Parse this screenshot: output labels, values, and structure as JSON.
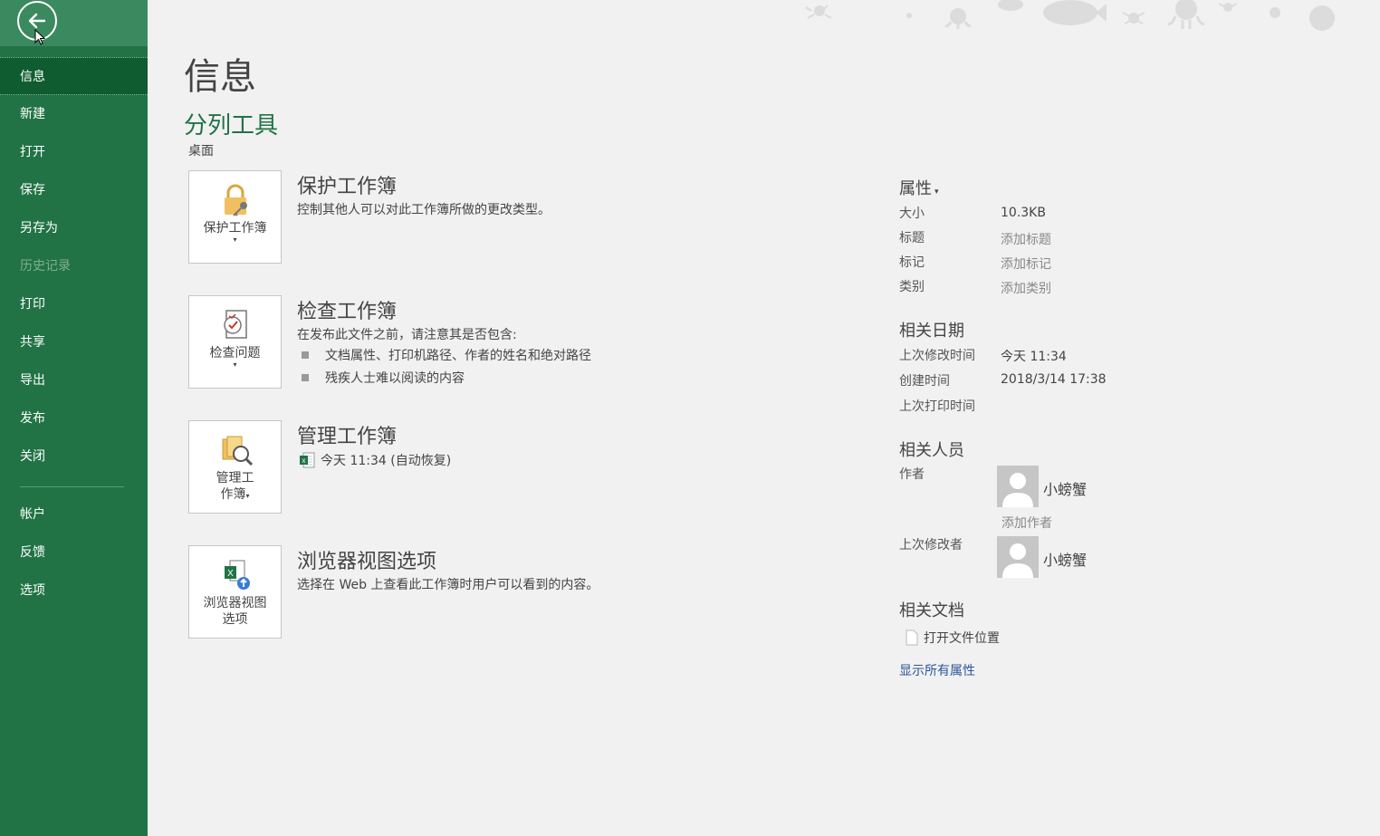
{
  "sidebar": {
    "back_label": "",
    "items": [
      {
        "label": "信息"
      },
      {
        "label": "新建"
      },
      {
        "label": "打开"
      },
      {
        "label": "保存"
      },
      {
        "label": "另存为"
      },
      {
        "label": "历史记录"
      },
      {
        "label": "打印"
      },
      {
        "label": "共享"
      },
      {
        "label": "导出"
      },
      {
        "label": "发布"
      },
      {
        "label": "关闭"
      },
      {
        "label": "帐户"
      },
      {
        "label": "反馈"
      },
      {
        "label": "选项"
      }
    ]
  },
  "main": {
    "title": "信息",
    "file_name": "分列工具",
    "file_location": "桌面",
    "sections": {
      "protect": {
        "tile_label": "保护工作簿",
        "title": "保护工作簿",
        "desc": "控制其他人可以对此工作簿所做的更改类型。"
      },
      "inspect": {
        "tile_label": "检查问题",
        "title": "检查工作簿",
        "desc": "在发布此文件之前，请注意其是否包含:",
        "bullets": [
          "文档属性、打印机路径、作者的姓名和绝对路径",
          "残疾人士难以阅读的内容"
        ]
      },
      "manage": {
        "tile_label_1": "管理工",
        "tile_label_2": "作簿",
        "title": "管理工作簿",
        "recover_item": "今天 11:34 (自动恢复)"
      },
      "browser": {
        "tile_label_1": "浏览器视图",
        "tile_label_2": "选项",
        "title": "浏览器视图选项",
        "desc": "选择在 Web 上查看此工作簿时用户可以看到的内容。"
      }
    }
  },
  "properties": {
    "header": "属性",
    "size_label": "大小",
    "size_value": "10.3KB",
    "title_label": "标题",
    "title_value": "添加标题",
    "tags_label": "标记",
    "tags_value": "添加标记",
    "category_label": "类别",
    "category_value": "添加类别",
    "dates_header": "相关日期",
    "modified_label": "上次修改时间",
    "modified_value": "今天 11:34",
    "created_label": "创建时间",
    "created_value": "2018/3/14 17:38",
    "printed_label": "上次打印时间",
    "printed_value": "",
    "people_header": "相关人员",
    "author_label": "作者",
    "author_name": "小螃蟹",
    "add_author": "添加作者",
    "last_modified_by_label": "上次修改者",
    "last_modified_by_name": "小螃蟹",
    "docs_header": "相关文档",
    "open_location": "打开文件位置",
    "show_all": "显示所有属性"
  },
  "colors": {
    "brand": "#217346",
    "sidebar_active": "#0e5c30",
    "link": "#2b579a"
  }
}
